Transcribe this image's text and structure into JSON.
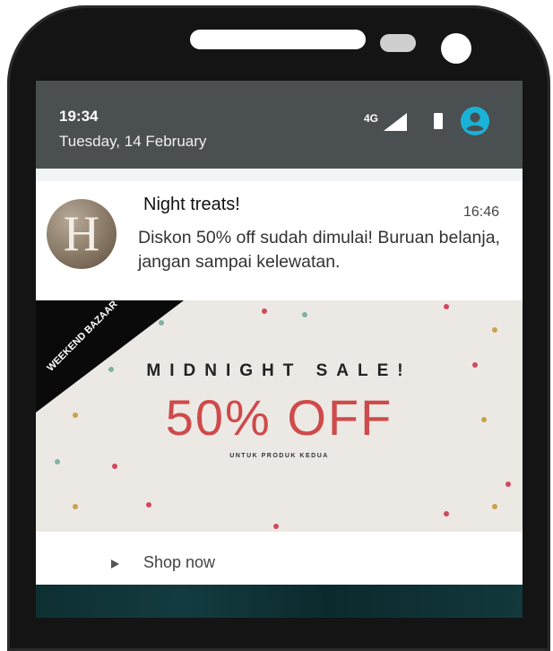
{
  "status_bar": {
    "time": "19:34",
    "date": "Tuesday, 14 February",
    "network": "4G",
    "icons": [
      "signal-icon",
      "battery-icon",
      "account-icon"
    ],
    "accent_color": "#1ab3d8"
  },
  "notification": {
    "app_logo_letter": "H",
    "title": "Night treats!",
    "time": "16:46",
    "body": "Diskon 50% off sudah dimulai! Buruan belanja, jangan sampai kelewatan."
  },
  "banner": {
    "ribbon_text": "WEEKEND BAZAAR",
    "heading": "MIDNIGHT SALE!",
    "offer": "50% OFF",
    "subtitle": "UNTUK PRODUK KEDUA",
    "offer_color": "#cf4a4a"
  },
  "action": {
    "label": "Shop now",
    "icon": "play-icon"
  }
}
